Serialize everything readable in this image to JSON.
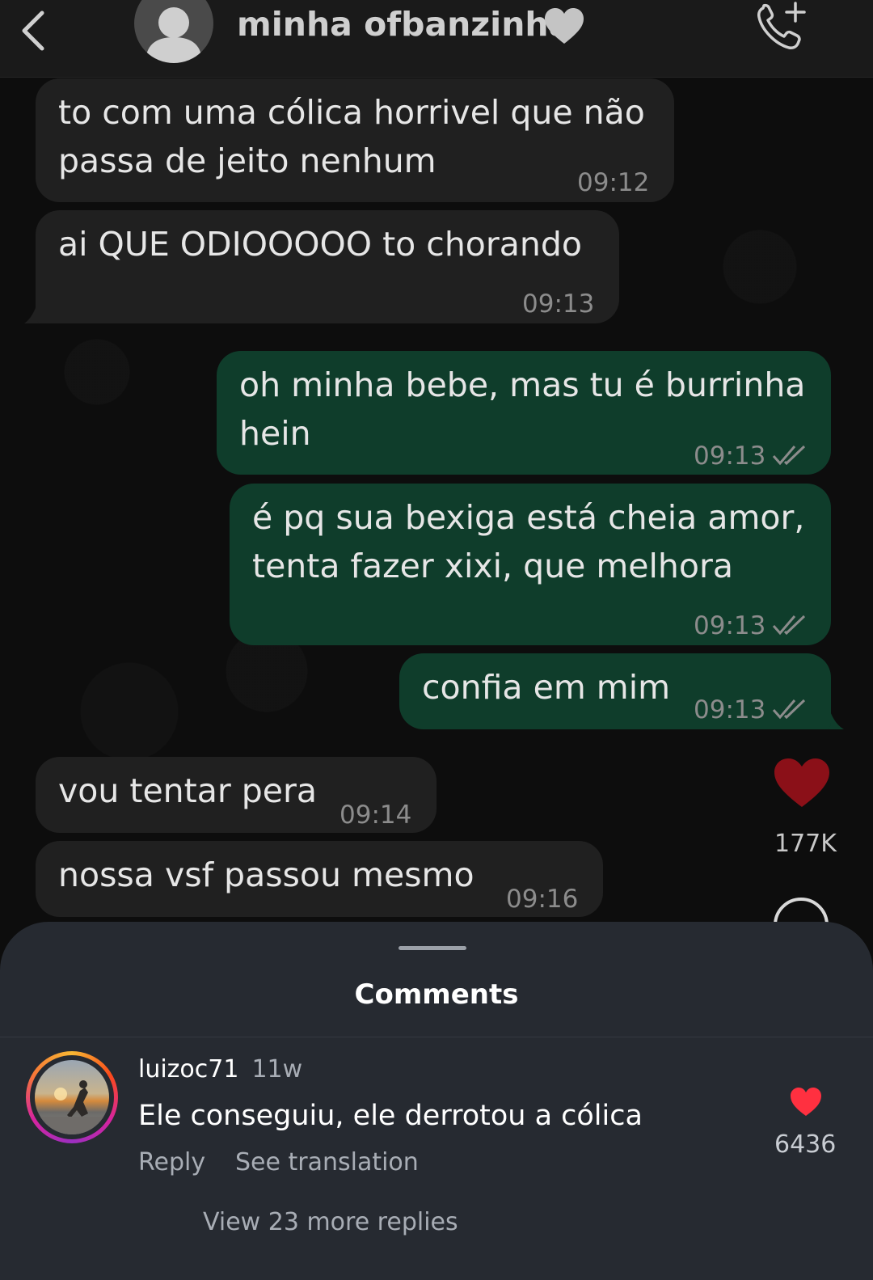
{
  "header": {
    "title": "minha ofbanzinha"
  },
  "messages": [
    {
      "direction": "in",
      "text": "to com uma cólica horrivel que não\npassa de jeito nenhum",
      "time": "09:12"
    },
    {
      "direction": "in",
      "text": "ai QUE ODIOOOOO to chorando",
      "time": "09:13"
    },
    {
      "direction": "out",
      "text": "oh minha bebe, mas tu é burrinha\nhein",
      "time": "09:13"
    },
    {
      "direction": "out",
      "text": "é pq sua bexiga está cheia amor,\ntenta fazer xixi, que melhora",
      "time": "09:13"
    },
    {
      "direction": "out",
      "text": "confia em mim",
      "time": "09:13"
    },
    {
      "direction": "in",
      "text": "vou tentar pera",
      "time": "09:14"
    },
    {
      "direction": "in",
      "text": "nossa vsf passou mesmo",
      "time": "09:16"
    }
  ],
  "actions": {
    "like_count": "177K"
  },
  "comments_sheet": {
    "title": "Comments",
    "comment": {
      "username": "luizoc71",
      "age": "11w",
      "text": "Ele conseguiu, ele derrotou a cólica",
      "reply_label": "Reply",
      "translate_label": "See translation",
      "likes": "6436"
    },
    "more_replies": "View 23 more replies"
  },
  "colors": {
    "incoming_bubble": "#202020",
    "outgoing_bubble": "#0f3d2b",
    "like_red": "#8b1018",
    "comment_like_red": "#ff3040"
  }
}
